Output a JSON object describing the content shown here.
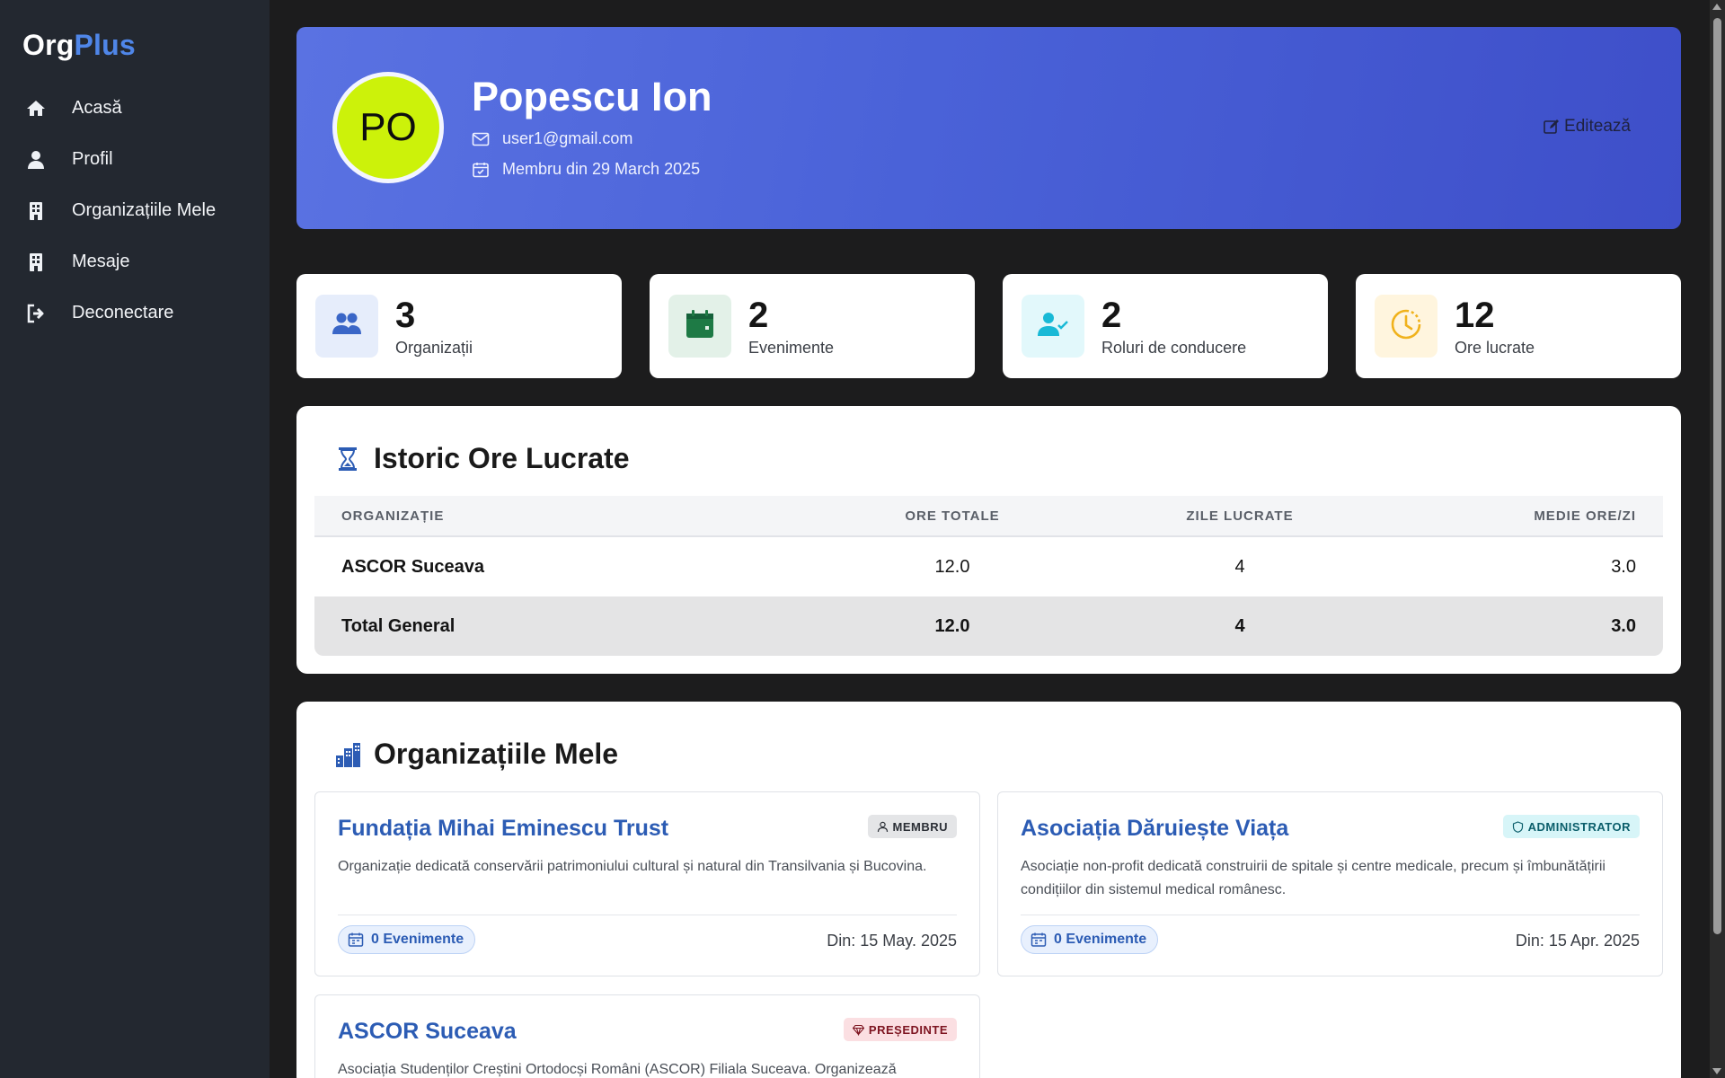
{
  "brand": {
    "part1": "Org",
    "part2": "Plus"
  },
  "sidebar": {
    "items": [
      {
        "label": "Acasă",
        "icon": "home-icon"
      },
      {
        "label": "Profil",
        "icon": "user-icon"
      },
      {
        "label": "Organizațiile Mele",
        "icon": "building-icon"
      },
      {
        "label": "Mesaje",
        "icon": "building-icon"
      },
      {
        "label": "Deconectare",
        "icon": "logout-icon"
      }
    ]
  },
  "profile": {
    "initials": "PO",
    "name": "Popescu Ion",
    "email": "user1@gmail.com",
    "member_since": "Membru din 29 March 2025",
    "edit_label": "Editează",
    "avatar_color": "#ccf20a"
  },
  "stats": [
    {
      "value": "3",
      "label": "Organizații",
      "icon": "users-icon",
      "color": "#3a66c7",
      "bg": "#e6edfb"
    },
    {
      "value": "2",
      "label": "Evenimente",
      "icon": "calendar-icon",
      "color": "#1e7a45",
      "bg": "#e3f1e8"
    },
    {
      "value": "2",
      "label": "Roluri de conducere",
      "icon": "user-check-icon",
      "color": "#18b9d6",
      "bg": "#e2f8fb"
    },
    {
      "value": "12",
      "label": "Ore lucrate",
      "icon": "clock-icon",
      "color": "#f0b21c",
      "bg": "#fff5de"
    }
  ],
  "hours": {
    "title": "Istoric Ore Lucrate",
    "columns": [
      "ORGANIZAȚIE",
      "ORE TOTALE",
      "ZILE LUCRATE",
      "MEDIE ORE/ZI"
    ],
    "rows": [
      {
        "org": "ASCOR Suceava",
        "total": "12.0",
        "days": "4",
        "avg": "3.0"
      }
    ],
    "total_row": {
      "org": "Total General",
      "total": "12.0",
      "days": "4",
      "avg": "3.0"
    }
  },
  "orgs": {
    "title": "Organizațiile Mele",
    "items": [
      {
        "name": "Fundația Mihai Eminescu Trust",
        "role": "MEMBRU",
        "role_icon": "user-icon",
        "role_bg": "#e4e5e7",
        "role_color": "#2b2f36",
        "description": "Organizație dedicată conservării patrimoniului cultural și natural din Transilvania și Bucovina.",
        "events": "0 Evenimente",
        "since": "Din: 15 May. 2025"
      },
      {
        "name": "Asociația Dăruiește Viața",
        "role": "ADMINISTRATOR",
        "role_icon": "shield-icon",
        "role_bg": "#d7f5f8",
        "role_color": "#0b5e6b",
        "description": "Asociație non-profit dedicată construirii de spitale și centre medicale, precum și îmbunătățirii condițiilor din sistemul medical românesc.",
        "events": "0 Evenimente",
        "since": "Din: 15 Apr. 2025"
      },
      {
        "name": "ASCOR Suceava",
        "role": "PREȘEDINTE",
        "role_icon": "diamond-icon",
        "role_bg": "#fbdfe2",
        "role_color": "#7d1420",
        "description": "Asociația Studenților Creștini Ortodocși Români (ASCOR) Filiala Suceava. Organizează",
        "events": "",
        "since": ""
      }
    ]
  }
}
